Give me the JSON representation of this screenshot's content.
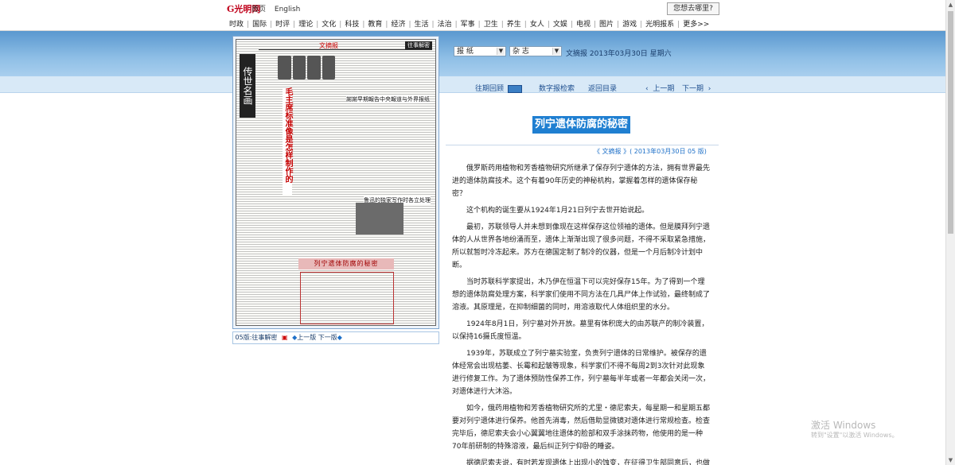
{
  "header": {
    "logo": "G光明网",
    "links": [
      "首页",
      "English"
    ],
    "search_button": "您想去哪里?"
  },
  "nav": {
    "items": [
      "时政",
      "国际",
      "时评",
      "理论",
      "文化",
      "科技",
      "教育",
      "经济",
      "生活",
      "法治",
      "军事",
      "卫生",
      "养生",
      "女人",
      "文娱",
      "电视",
      "图片",
      "游戏",
      "光明报系",
      "更多>>"
    ]
  },
  "toolbar": {
    "paper_select": "报 纸",
    "category_select": "杂 志",
    "paper_name": "文摘报",
    "date": "2013年03月30日",
    "weekday": "星期六"
  },
  "subnav": {
    "past_review": "往期回顾",
    "digital_search": "数字报检索",
    "back_to_index": "返回目录",
    "prev_issue": "上一期",
    "next_issue": "下一期"
  },
  "page_thumb": {
    "section_vertical": "传世名画",
    "masthead_brand": "文摘报",
    "masthead_tag": "往事解密",
    "red_headline": "毛主席标准像是怎样制作的",
    "headline_2": "謝謝早期報告中央報道与外界报纸",
    "headline_3": "鲁迅的独家写作时各立处理",
    "box_title": "列宁遗体防腐的秘密"
  },
  "page_caption": {
    "page_label": "05版:往事解密",
    "prev_page": "上一版",
    "next_page": "下一版"
  },
  "article": {
    "title": "列宁遗体防腐的秘密",
    "source": "《 文摘报 》( 2013年03月30日  05 版)",
    "paragraphs": [
      "俄罗斯药用植物和芳香植物研究所继承了保存列宁遗体的方法，拥有世界最先进的遗体防腐技术。这个有着90年历史的神秘机构，掌握着怎样的遗体保存秘密？",
      "这个机构的诞生要从1924年1月21日列宁去世开始说起。",
      "最初，苏联领导人并未想到像现在这样保存这位领袖的遗体。但是膜拜列宁遗体的人从世界各地纷涌而至，遗体上渐渐出现了很多问题，不得不采取紧急措施，所以就暂时冷冻起来。苏方在德国定制了制冷的仪器，但是一个月后制冷计划中断。",
      "当时苏联科学家提出，木乃伊在恒温下可以完好保存15年。为了得到一个理想的遗体防腐处理方案，科学家们使用不同方法在几具尸体上作试验，最终制成了溶液。其原理是，在抑制细菌的同时，用溶液取代人体组织里的水分。",
      "1924年8月1日，列宁墓对外开放。墓里有体积庞大的由苏联产的制冷装置，以保持16摄氏度恒温。",
      "1939年，苏联成立了列宁墓实验室，负责列宁遗体的日常维护。被保存的遗体经常会出现枯萎、长霉和起皱等现象，科学家们不得不每周2到3次针对此现象进行修复工作。为了遗体预防性保养工作，列宁墓每半年或者一年都会关闭一次，对遗体进行大沐浴。",
      "如今，俄药用植物和芳香植物研究所的尤里・德尼索夫，每星期一和星期五都要对列宁遗体进行保养。他首先消毒，然后借助显微镜对遗体进行常规检查。检查完毕后，德尼索夫会小心翼翼地往遗体的脸部和双手涂抹药物，他使用的是一种70年前研制的特殊溶液，最后纠正列宁仰卧的睡姿。",
      "据德尼索夫说，有时若发现遗体上出现小的蚀变，在征得卫生部同意后，也做过极小的细胞移植手术。但这种情况很罕见。"
    ]
  },
  "watermark": {
    "line1": "激活 Windows",
    "line2": "转到\"设置\"以激活 Windows。"
  }
}
